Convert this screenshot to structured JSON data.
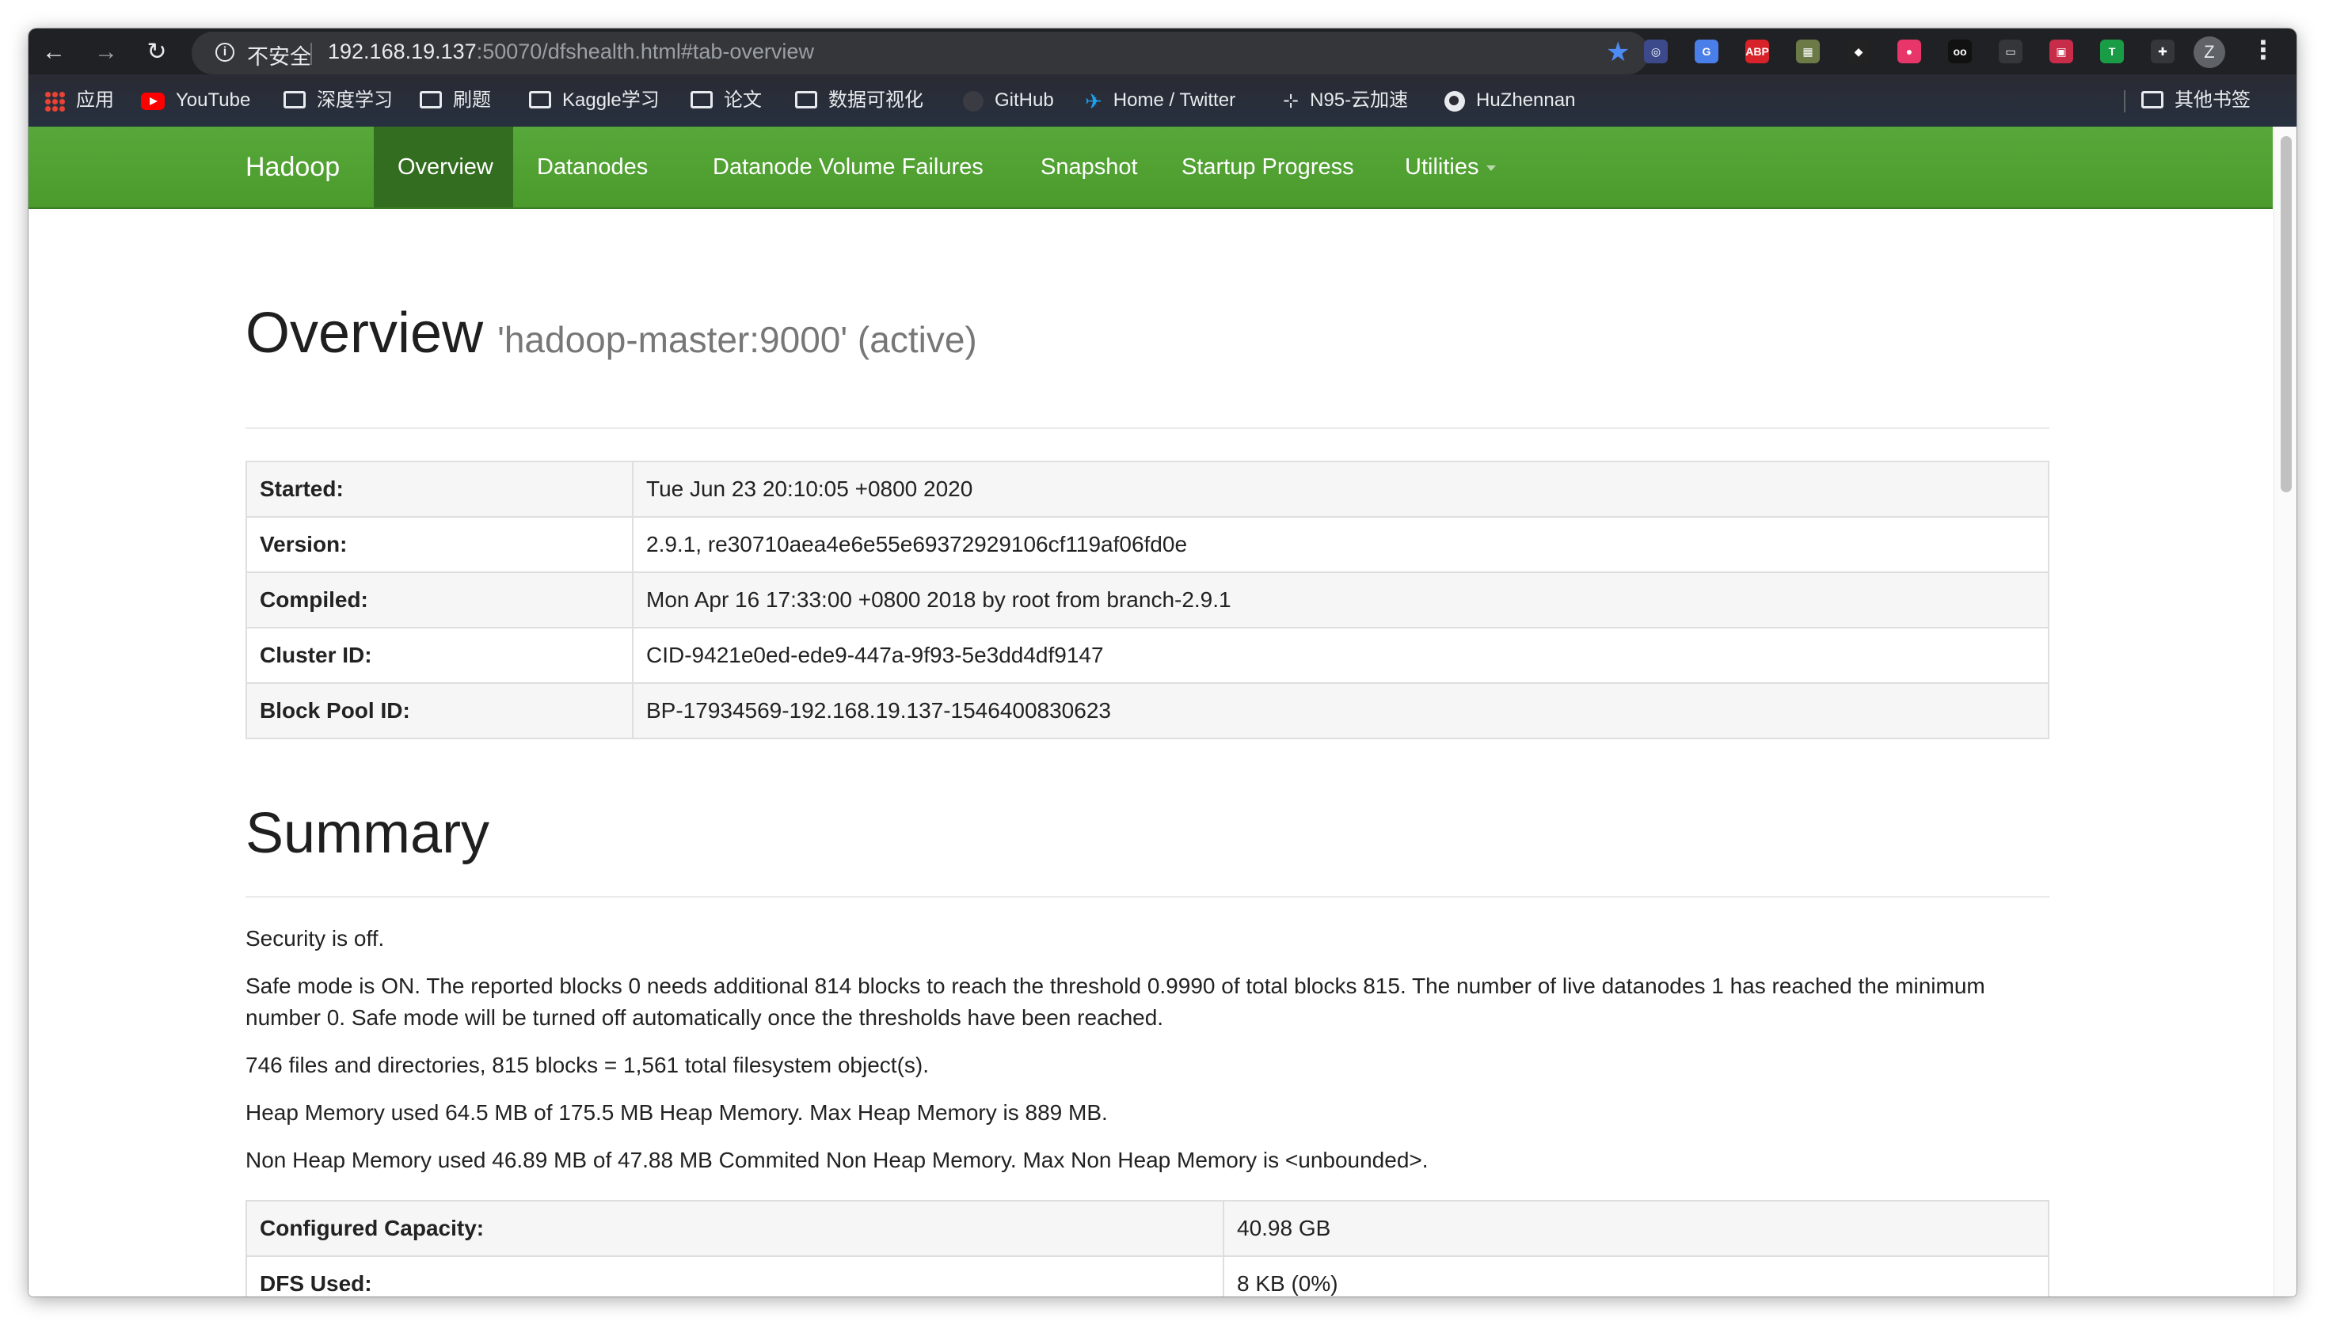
{
  "browser": {
    "security_label": "不安全",
    "url_host": "192.168.19.137",
    "url_rest": ":50070/dfshealth.html#tab-overview",
    "avatar_initial": "Z",
    "extensions": [
      {
        "name": "extension-1",
        "label": "◎",
        "color": "#3c4a8c"
      },
      {
        "name": "extension-translate",
        "label": "G",
        "color": "#4a7ee8"
      },
      {
        "name": "extension-adblock",
        "label": "ABP",
        "color": "#d8222a"
      },
      {
        "name": "extension-4",
        "label": "▦",
        "color": "#6b7a46"
      },
      {
        "name": "extension-5",
        "label": "◆",
        "color": "#222"
      },
      {
        "name": "extension-6",
        "label": "●",
        "color": "#e8356a"
      },
      {
        "name": "extension-7",
        "label": "oo",
        "color": "#111"
      },
      {
        "name": "extension-8",
        "label": "▭",
        "color": "#35363a"
      },
      {
        "name": "extension-9",
        "label": "▣",
        "color": "#c72c48"
      },
      {
        "name": "extension-10",
        "label": "T",
        "color": "#1a9c47"
      },
      {
        "name": "extensions-menu",
        "label": "✚",
        "color": "#35363a"
      }
    ]
  },
  "bookmarks": [
    {
      "name": "bookmark-apps",
      "label": "应用",
      "icon": "apps-icon"
    },
    {
      "name": "bookmark-youtube",
      "label": "YouTube",
      "icon": "youtube-icon"
    },
    {
      "name": "bookmark-folder-deep-learning",
      "label": "深度学习",
      "icon": "folder-icon"
    },
    {
      "name": "bookmark-folder-practice",
      "label": "刷题",
      "icon": "folder-icon"
    },
    {
      "name": "bookmark-folder-kaggle",
      "label": "Kaggle学习",
      "icon": "folder-icon"
    },
    {
      "name": "bookmark-folder-papers",
      "label": "论文",
      "icon": "folder-icon"
    },
    {
      "name": "bookmark-folder-dataviz",
      "label": "数据可视化",
      "icon": "folder-icon"
    },
    {
      "name": "bookmark-github",
      "label": "GitHub",
      "icon": "github-icon"
    },
    {
      "name": "bookmark-twitter",
      "label": "Home / Twitter",
      "icon": "twitter-icon"
    },
    {
      "name": "bookmark-n95",
      "label": "N95-云加速",
      "icon": "n95-icon"
    },
    {
      "name": "bookmark-huzhennan",
      "label": "HuZhennan",
      "icon": "globe-icon"
    }
  ],
  "other_bookmarks": "其他书签",
  "hadoop_nav": {
    "brand": "Hadoop",
    "items": [
      "Overview",
      "Datanodes",
      "Datanode Volume Failures",
      "Snapshot",
      "Startup Progress",
      "Utilities"
    ],
    "active": "Overview"
  },
  "overview": {
    "title": "Overview",
    "subtitle": "'hadoop-master:9000' (active)",
    "rows": [
      {
        "key": "Started:",
        "value": "Tue Jun 23 20:10:05 +0800 2020"
      },
      {
        "key": "Version:",
        "value": "2.9.1, re30710aea4e6e55e69372929106cf119af06fd0e"
      },
      {
        "key": "Compiled:",
        "value": "Mon Apr 16 17:33:00 +0800 2018 by root from branch-2.9.1"
      },
      {
        "key": "Cluster ID:",
        "value": "CID-9421e0ed-ede9-447a-9f93-5e3dd4df9147"
      },
      {
        "key": "Block Pool ID:",
        "value": "BP-17934569-192.168.19.137-1546400830623"
      }
    ]
  },
  "summary": {
    "title": "Summary",
    "security": "Security is off.",
    "safemode": "Safe mode is ON. The reported blocks 0 needs additional 814 blocks to reach the threshold 0.9990 of total blocks 815. The number of live datanodes 1 has reached the minimum number 0. Safe mode will be turned off automatically once the thresholds have been reached.",
    "files": "746 files and directories, 815 blocks = 1,561 total filesystem object(s).",
    "heap": "Heap Memory used 64.5 MB of 175.5 MB Heap Memory. Max Heap Memory is 889 MB.",
    "nonheap": "Non Heap Memory used 46.89 MB of 47.88 MB Commited Non Heap Memory. Max Non Heap Memory is <unbounded>.",
    "rows": [
      {
        "key": "Configured Capacity:",
        "value": "40.98 GB"
      },
      {
        "key": "DFS Used:",
        "value": "8 KB (0%)"
      }
    ]
  }
}
